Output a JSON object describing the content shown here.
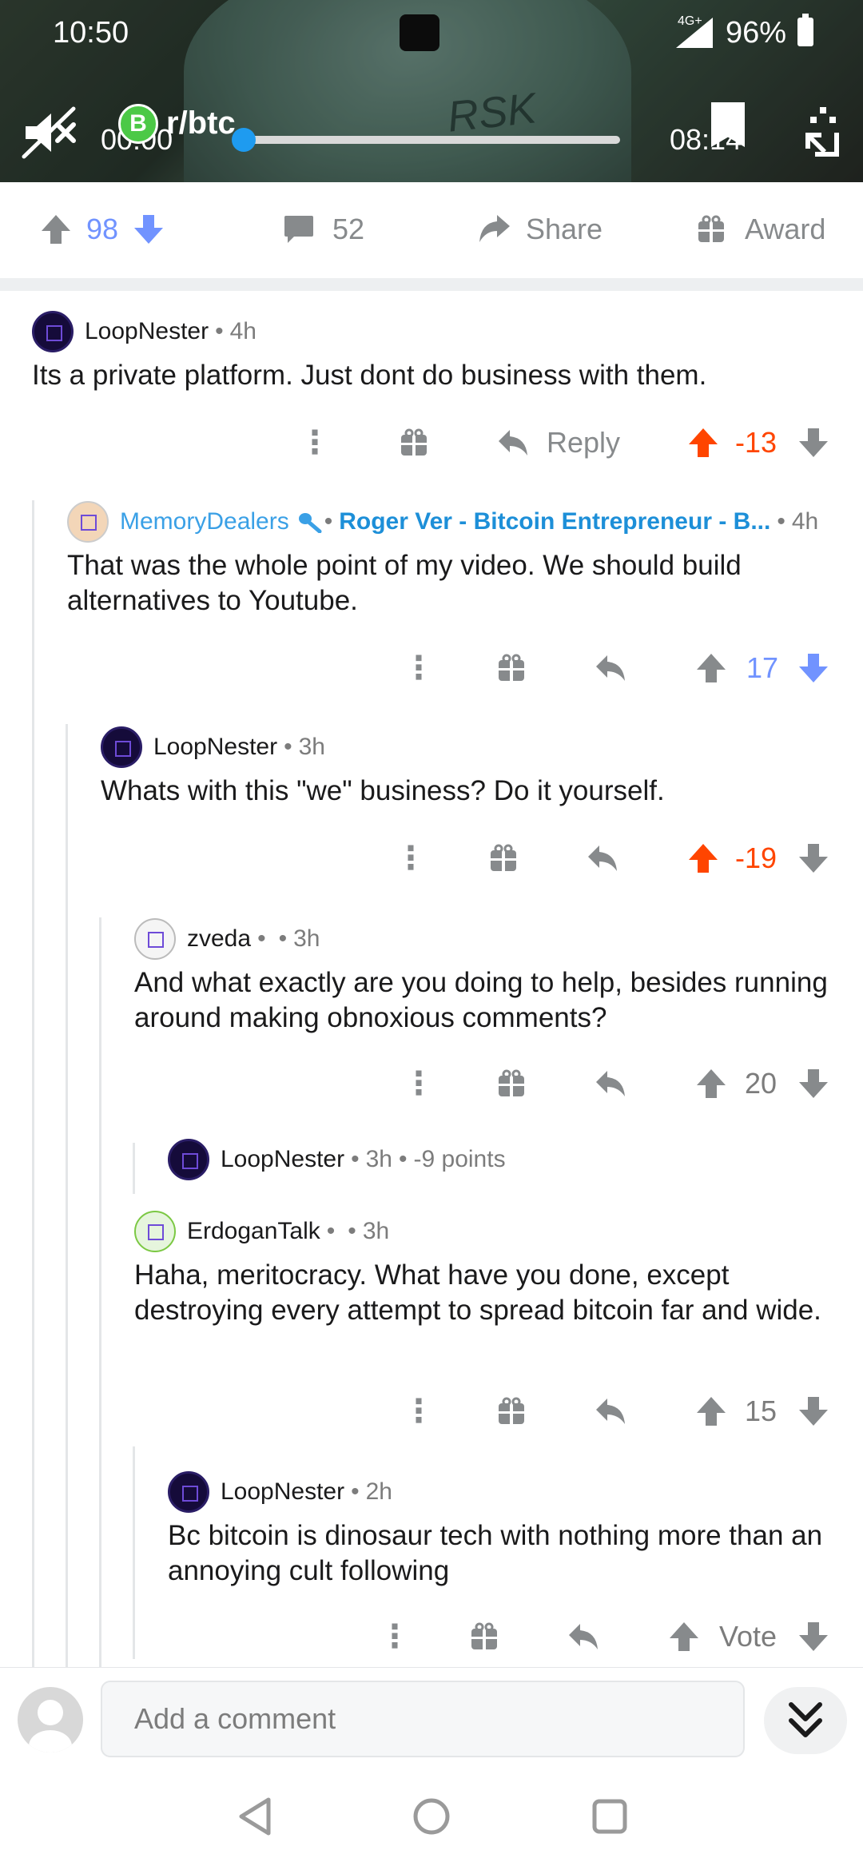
{
  "status_bar": {
    "time": "10:50",
    "network": "4G+",
    "battery": "96%"
  },
  "video": {
    "current_time": "00:00",
    "subreddit": "r/btc",
    "total_time": "08:14",
    "progress": 0.0,
    "subreddit_icon_letter": "B"
  },
  "post_actions": {
    "score": "98",
    "comments": "52",
    "share": "Share",
    "award": "Award"
  },
  "comments": [
    {
      "user": "LoopNester",
      "sep": "•",
      "age": "4h",
      "body": "Its a private platform. Just dont do business with them.",
      "reply_label": "Reply",
      "score": "-13"
    },
    {
      "user": "MemoryDealers",
      "sep": "•",
      "flair": "Roger Ver - Bitcoin Entrepreneur - B...",
      "sep2": "•",
      "age": "4h",
      "body": "That was the whole point of my video.  We should build alternatives to Youtube.",
      "score": "17"
    },
    {
      "user": "LoopNester",
      "sep": "•",
      "age": "3h",
      "body": "Whats with this \"we\" business? Do it yourself.",
      "score": "-19"
    },
    {
      "user": "zveda",
      "sep": "•",
      "sep2": "•",
      "age": "3h",
      "body": "And what exactly are you doing to help, besides running around making obnoxious comments?",
      "score": "20"
    },
    {
      "user": "LoopNester",
      "sep": "•",
      "age": "3h",
      "sep2": "•",
      "points": "-9 points"
    },
    {
      "user": "ErdoganTalk",
      "sep": "•",
      "sep2": "•",
      "age": "3h",
      "body": "Haha, meritocracy. What have you done, except destroying every attempt to spread bitcoin far and wide.",
      "score": "15"
    },
    {
      "user": "LoopNester",
      "sep": "•",
      "age": "2h",
      "body": "Bc bitcoin is dinosaur tech with nothing more than an annoying cult following",
      "score": "Vote"
    }
  ],
  "comment_bar": {
    "placeholder": "Add a comment"
  },
  "colors": {
    "upvote": "#ff4500",
    "downvote": "#7193ff",
    "link_blue": "#3aa0e6",
    "text": "#1a1a1b",
    "meta": "#7c7c7c"
  },
  "icons": [
    "mute-icon",
    "bookmark-icon",
    "fullscreen-icon",
    "upvote-icon",
    "downvote-icon",
    "comment-icon",
    "share-icon",
    "gift-icon",
    "more-icon",
    "reply-icon",
    "collapse-icon",
    "back-icon",
    "home-icon",
    "recents-icon"
  ]
}
